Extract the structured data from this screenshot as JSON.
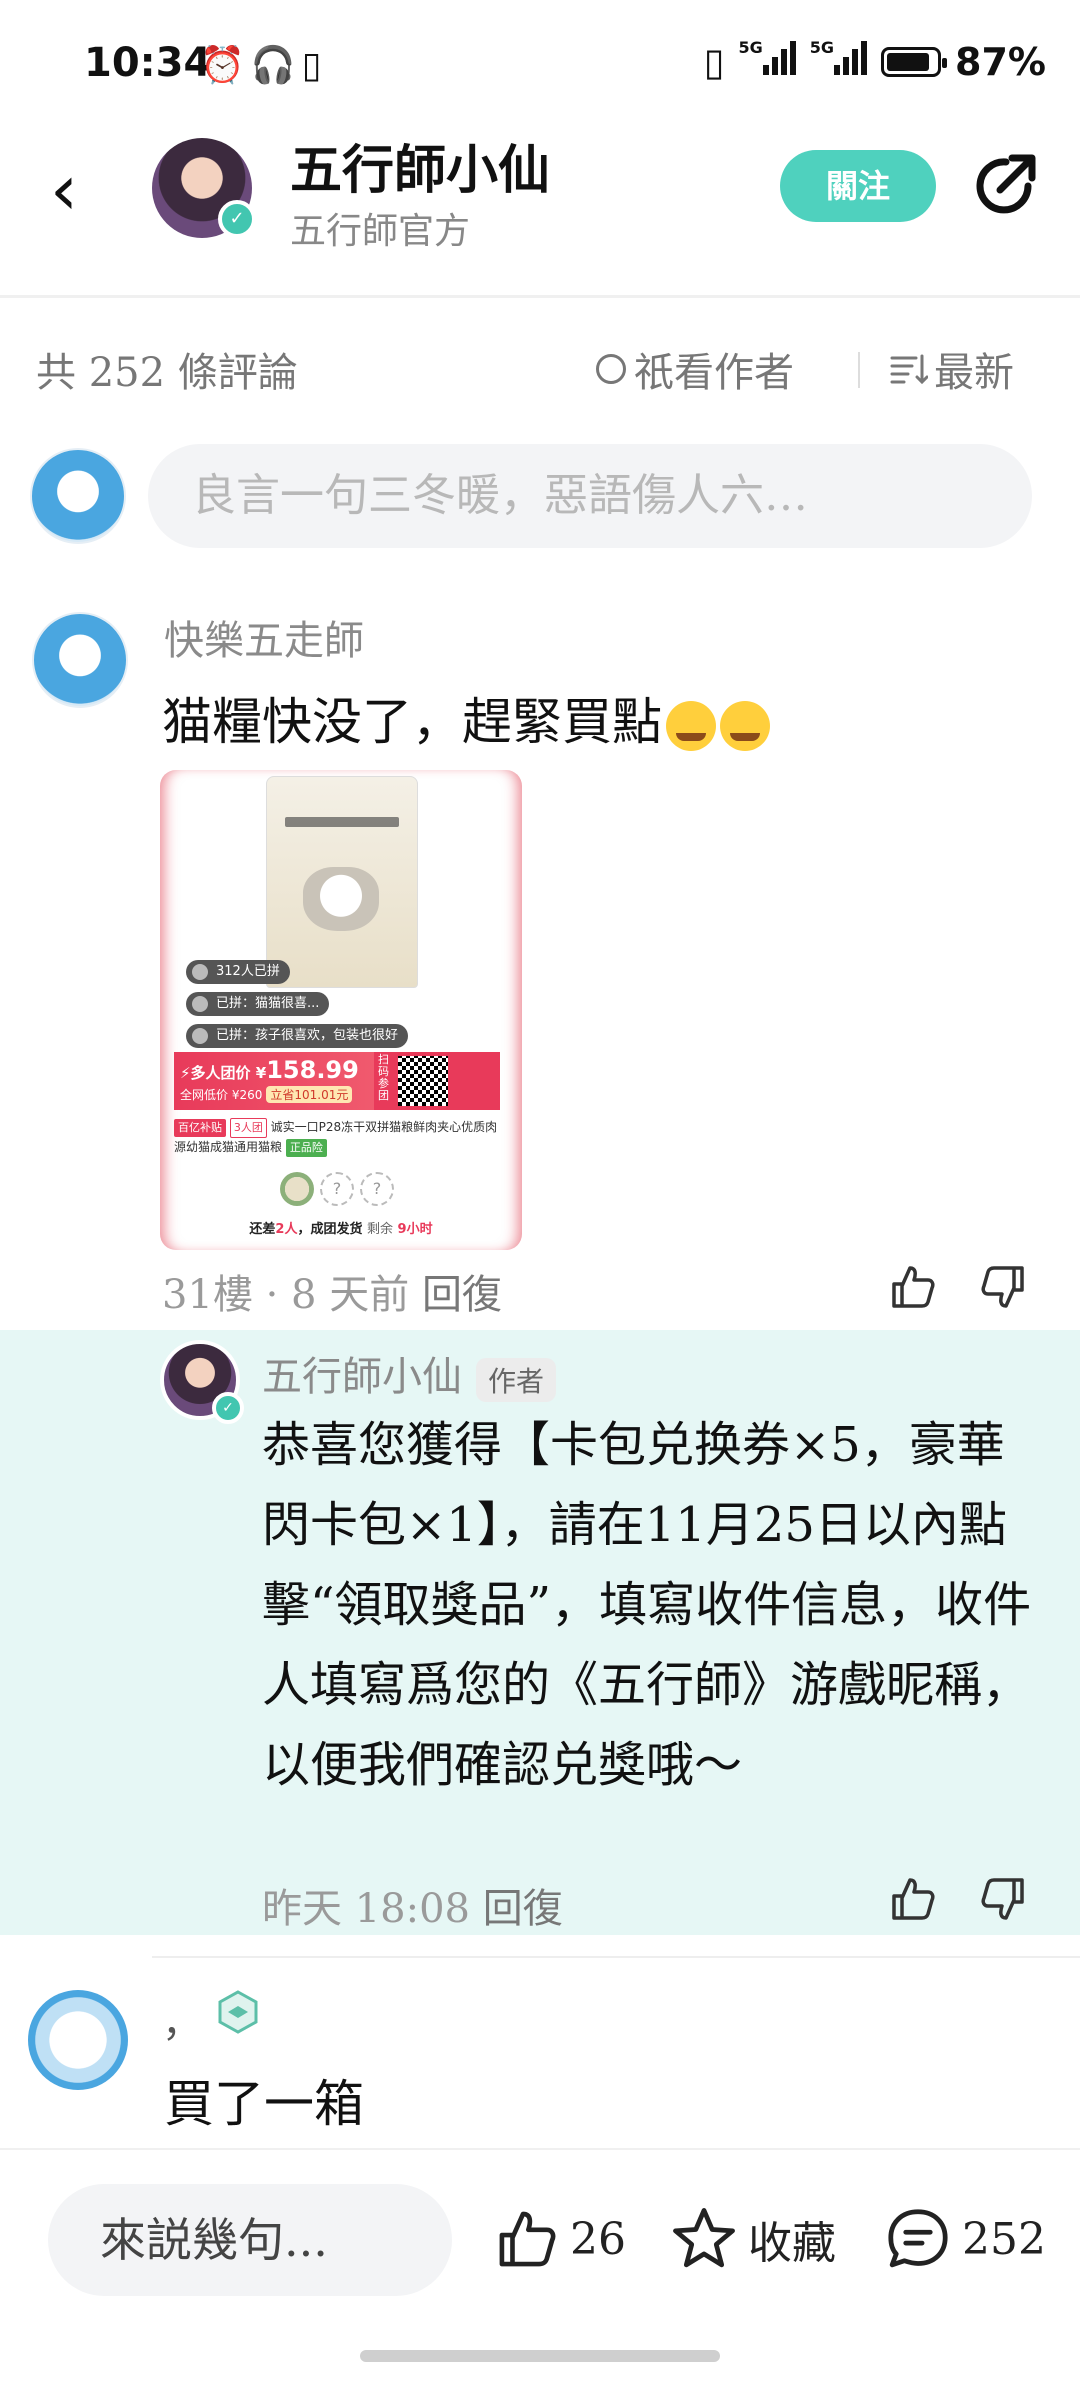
{
  "status_bar": {
    "time": "10:34",
    "network1": "5G",
    "network2": "5G",
    "battery": "87%"
  },
  "header": {
    "title": "五行師小仙",
    "subtitle": "五行師官方",
    "follow_label": "關注"
  },
  "comments_header": {
    "count_text": "共 252 條評論",
    "only_author_label": "祇看作者",
    "sort_label": "最新"
  },
  "composer": {
    "placeholder": "良言一句三冬暖，惡語傷人六…"
  },
  "comments": [
    {
      "user": "快樂五走師",
      "text": "猫糧快没了，趕緊買點",
      "product": {
        "chip1": "312人已拼",
        "chip2": "已拼：猫猫很喜...",
        "chip3": "已拼：孩子很喜欢，包装也很好",
        "price_label": "多人团价 ¥",
        "price": "158.99",
        "low_price": "全网低价 ¥260",
        "save": "立省101.01元",
        "qr_label": "扫码参团",
        "tag1": "百亿补贴",
        "tag2": "3人团",
        "desc": "诚实一口P28冻干双拼猫粮鲜肉夹心优质肉源幼猫成猫通用猫粮",
        "tag3": "正品险",
        "footer_prefix": "还差",
        "footer_count": "2人",
        "footer_mid": "，成团发货",
        "footer_remain": "剩余",
        "footer_time": "9小时"
      },
      "meta": "31樓 · 8 天前",
      "reply_label": "回復"
    },
    {
      "user": "五行師小仙",
      "author_tag": "作者",
      "text": "恭喜您獲得【卡包兑换券×5，豪華閃卡包×1】，請在11月25日以內點擊“領取獎品”，填寫收件信息，收件人填寫爲您的《五行師》游戲昵稱，以便我們確認兑獎哦～",
      "meta": "昨天 18:08",
      "reply_label": "回復"
    },
    {
      "user": "，",
      "text": "買了一箱"
    }
  ],
  "bottom_bar": {
    "say_placeholder": "來説幾句...",
    "likes": "26",
    "favorite_label": "收藏",
    "comments": "252"
  },
  "colors": {
    "accent": "#4fd1be",
    "reply_bg": "#e6f7f5",
    "price_red": "#e83a5a"
  }
}
